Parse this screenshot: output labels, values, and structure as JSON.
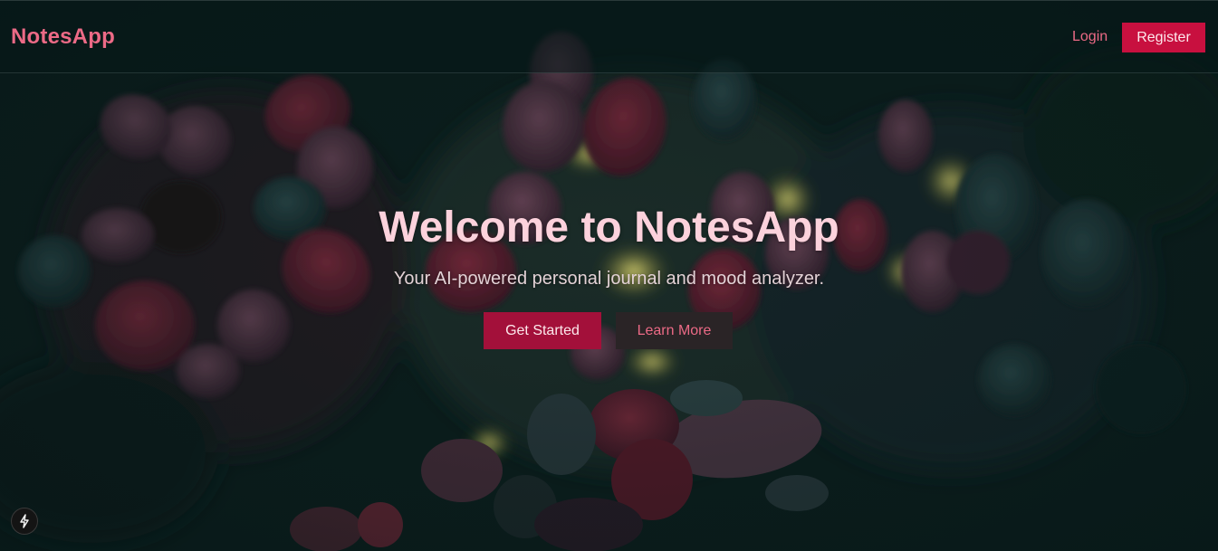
{
  "header": {
    "brand": "NotesApp",
    "login_label": "Login",
    "register_label": "Register"
  },
  "hero": {
    "title": "Welcome to NotesApp",
    "subtitle": "Your AI-powered personal journal and mood analyzer.",
    "primary_cta": "Get Started",
    "secondary_cta": "Learn More"
  },
  "icons": {
    "badge": "bolt-icon",
    "background": "flowers-background-image"
  },
  "colors": {
    "accent": "#ec6a86",
    "primary_button": "#a3103a",
    "register_button": "#c8103f",
    "secondary_button": "#2a2426",
    "title": "#fcd2dc"
  }
}
